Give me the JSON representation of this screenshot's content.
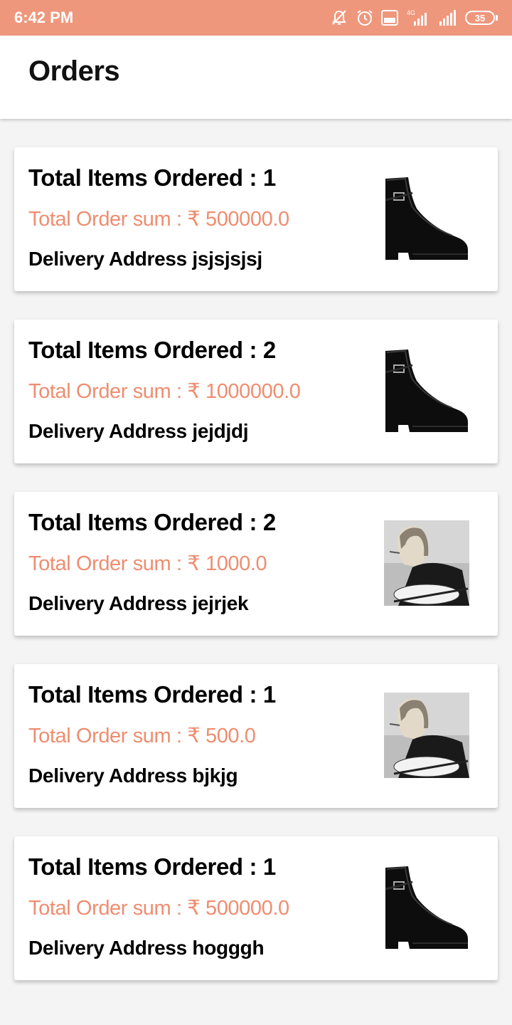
{
  "status_bar": {
    "time": "6:42 PM",
    "network_label": "4G",
    "battery": "35",
    "icons": [
      "mute-icon",
      "alarm-icon",
      "volte-icon",
      "signal-4g-icon",
      "signal-icon",
      "battery-icon"
    ]
  },
  "header": {
    "title": "Orders"
  },
  "orders": [
    {
      "items": "Total Items Ordered : 1",
      "sum": "Total Order sum : ₹ 500000.0",
      "address": "Delivery Address jsjsjsjsj",
      "image": "boot"
    },
    {
      "items": "Total Items Ordered : 2",
      "sum": "Total Order sum : ₹ 1000000.0",
      "address": "Delivery Address jejdjdj",
      "image": "boot"
    },
    {
      "items": "Total Items Ordered : 2",
      "sum": "Total Order sum : ₹ 1000.0",
      "address": "Delivery Address jejrjek",
      "image": "musician"
    },
    {
      "items": "Total Items Ordered : 1",
      "sum": "Total Order sum : ₹ 500.0",
      "address": "Delivery Address bjkjg",
      "image": "musician"
    },
    {
      "items": "Total Items Ordered : 1",
      "sum": "Total Order sum : ₹ 500000.0",
      "address": "Delivery Address hogggh",
      "image": "boot"
    }
  ],
  "colors": {
    "status_bar": "#ef977c",
    "accent_text": "#ef8d70"
  }
}
